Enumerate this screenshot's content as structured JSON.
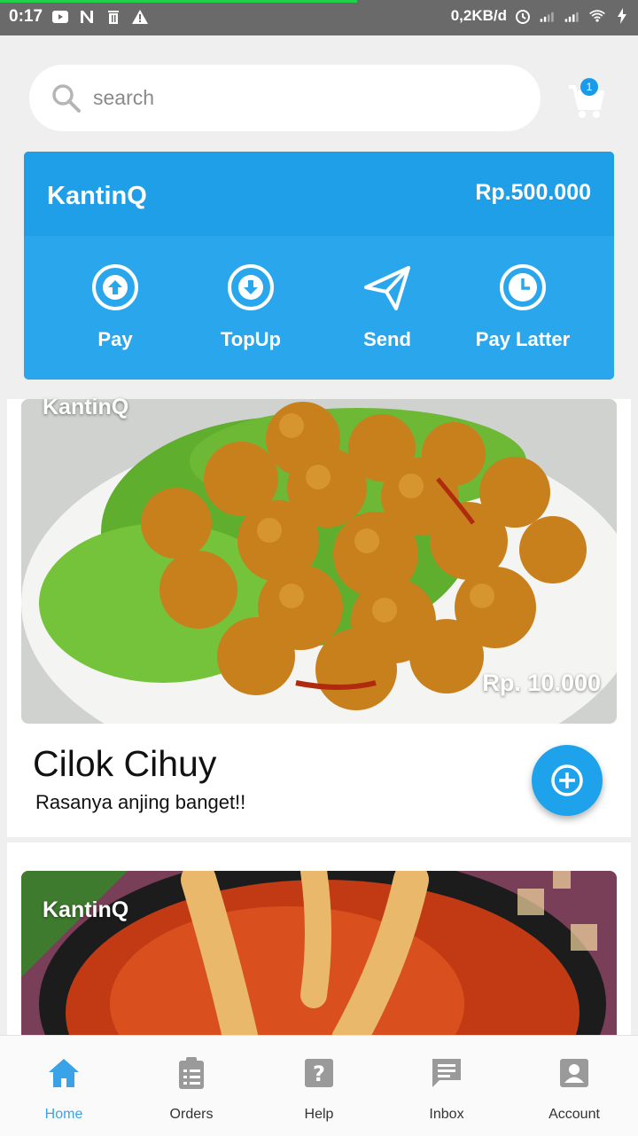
{
  "status_bar": {
    "time": "0:17",
    "speed": "0,2KB/d"
  },
  "search": {
    "placeholder": "search"
  },
  "cart": {
    "badge_count": "1"
  },
  "wallet": {
    "name": "KantinQ",
    "balance": "Rp.500.000",
    "actions": [
      {
        "label": "Pay",
        "icon": "arrow-up-circle-icon"
      },
      {
        "label": "TopUp",
        "icon": "arrow-down-circle-icon"
      },
      {
        "label": "Send",
        "icon": "paper-plane-icon"
      },
      {
        "label": "Pay Latter",
        "icon": "clock-icon"
      }
    ]
  },
  "menu_items": [
    {
      "brand": "KantinQ",
      "price": "Rp. 10.000",
      "title": "Cilok Cihuy",
      "description": "Rasanya anjing banget!!"
    },
    {
      "brand": "KantinQ"
    }
  ],
  "bottom_nav": [
    {
      "label": "Home",
      "icon": "home-icon",
      "active": true
    },
    {
      "label": "Orders",
      "icon": "clipboard-icon",
      "active": false
    },
    {
      "label": "Help",
      "icon": "help-icon",
      "active": false
    },
    {
      "label": "Inbox",
      "icon": "chat-icon",
      "active": false
    },
    {
      "label": "Account",
      "icon": "account-icon",
      "active": false
    }
  ],
  "colors": {
    "primary": "#1f9fe8",
    "status_bar": "#6a6a6a",
    "nav_active": "#3aa3e8"
  }
}
